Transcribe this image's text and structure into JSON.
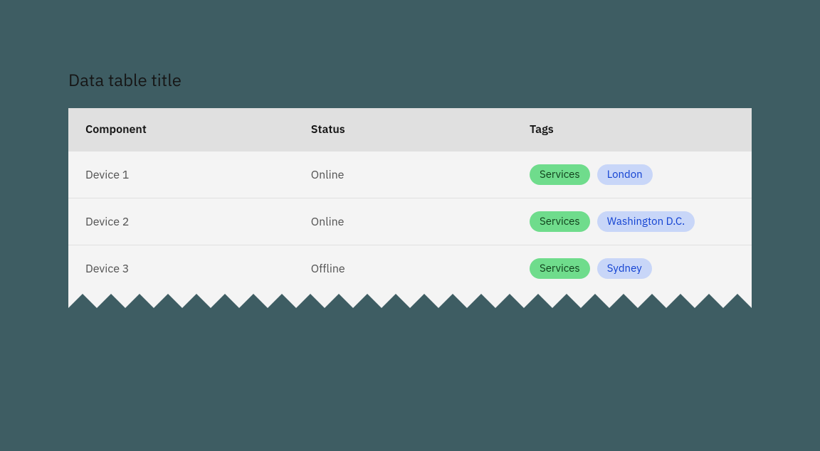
{
  "title": "Data table title",
  "columns": {
    "component": "Component",
    "status": "Status",
    "tags": "Tags"
  },
  "rows": [
    {
      "component": "Device 1",
      "status": "Online",
      "tags": [
        {
          "label": "Services",
          "color": "green"
        },
        {
          "label": "London",
          "color": "blue"
        }
      ]
    },
    {
      "component": "Device 2",
      "status": "Online",
      "tags": [
        {
          "label": "Services",
          "color": "green"
        },
        {
          "label": "Washington D.C.",
          "color": "blue"
        }
      ]
    },
    {
      "component": "Device 3",
      "status": "Offline",
      "tags": [
        {
          "label": "Services",
          "color": "green"
        },
        {
          "label": "Sydney",
          "color": "blue"
        }
      ]
    }
  ],
  "colors": {
    "page_bg": "#3e5d63",
    "table_bg": "#f4f4f4",
    "header_bg": "#e0e0e0",
    "tag_green_bg": "#6fdc8c",
    "tag_blue_bg": "#c8d6f8"
  }
}
